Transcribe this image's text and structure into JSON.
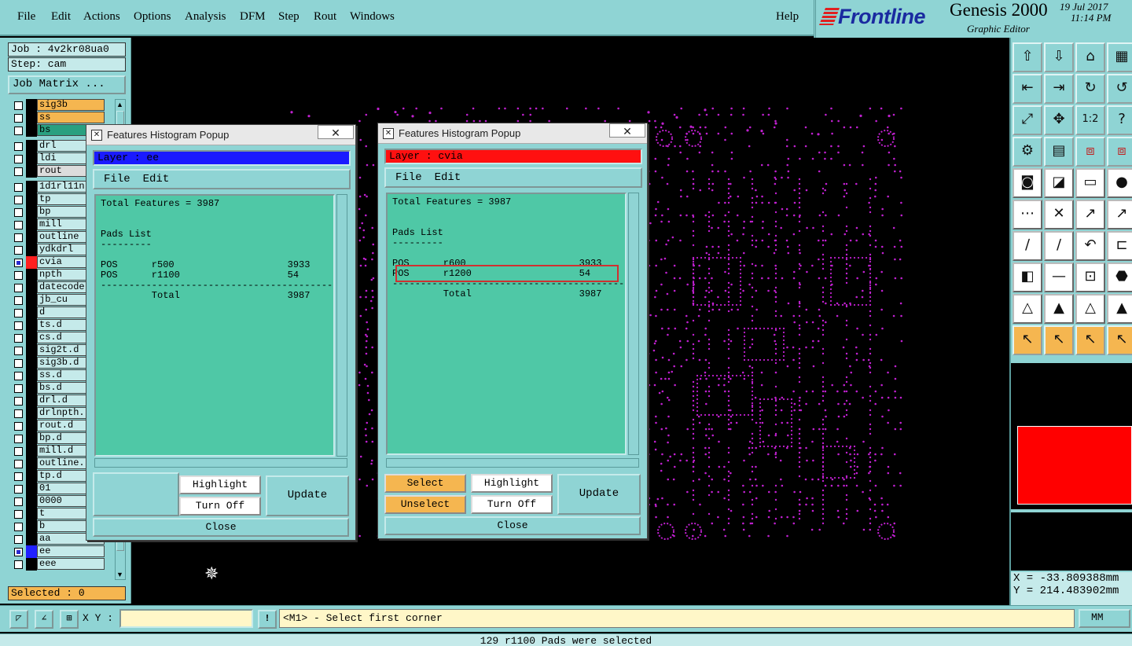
{
  "menubar": {
    "items": [
      "File",
      "Edit",
      "Actions",
      "Options",
      "Analysis",
      "DFM",
      "Step",
      "Rout",
      "Windows"
    ],
    "help": "Help"
  },
  "branding": {
    "logo": "Frontline",
    "product": "Genesis 2000",
    "subtitle": "Graphic Editor",
    "date": "19 Jul 2017",
    "time": "11:14 PM"
  },
  "job": {
    "job_label": "Job : 4v2kr08ua0",
    "step_label": "Step: cam",
    "matrix_button": "Job Matrix ..."
  },
  "layers": [
    {
      "name": "sig3b",
      "state": "sel",
      "arrow": true
    },
    {
      "name": "ss",
      "state": "sel",
      "arrow": true
    },
    {
      "name": "bs",
      "state": "bs",
      "arrow": true
    },
    {
      "name": "drl",
      "state": ""
    },
    {
      "name": "ldi",
      "state": ""
    },
    {
      "name": "rout",
      "state": "rt"
    },
    {
      "name": "1d1rl11n",
      "state": ""
    },
    {
      "name": "tp",
      "state": ""
    },
    {
      "name": "bp",
      "state": ""
    },
    {
      "name": "mill",
      "state": ""
    },
    {
      "name": "outline",
      "state": ""
    },
    {
      "name": "ydkdrl",
      "state": ""
    },
    {
      "name": "cvia",
      "state": "",
      "checked": true,
      "color": "#ff2020"
    },
    {
      "name": "npth",
      "state": ""
    },
    {
      "name": "datecode",
      "state": ""
    },
    {
      "name": "jb_cu",
      "state": ""
    },
    {
      "name": "d",
      "state": ""
    },
    {
      "name": "ts.d",
      "state": ""
    },
    {
      "name": "cs.d",
      "state": ""
    },
    {
      "name": "sig2t.d",
      "state": ""
    },
    {
      "name": "sig3b.d",
      "state": ""
    },
    {
      "name": "ss.d",
      "state": ""
    },
    {
      "name": "bs.d",
      "state": ""
    },
    {
      "name": "drl.d",
      "state": ""
    },
    {
      "name": "drlnpth.",
      "state": ""
    },
    {
      "name": "rout.d",
      "state": ""
    },
    {
      "name": "bp.d",
      "state": ""
    },
    {
      "name": "mill.d",
      "state": ""
    },
    {
      "name": "outline.",
      "state": ""
    },
    {
      "name": "tp.d",
      "state": ""
    },
    {
      "name": "01",
      "state": ""
    },
    {
      "name": "0000",
      "state": ""
    },
    {
      "name": "t",
      "state": ""
    },
    {
      "name": "b",
      "state": ""
    },
    {
      "name": "aa",
      "state": ""
    },
    {
      "name": "ee",
      "state": "",
      "checked": true,
      "color": "#2020ff"
    },
    {
      "name": "eee",
      "state": ""
    }
  ],
  "selected_label": "Selected : 0",
  "popup1": {
    "title": "Features Histogram Popup",
    "layer_label": "Layer :  ee",
    "layer_color": "#1a1aff",
    "menu": [
      "File",
      "Edit"
    ],
    "text": "Total Features = 3987\n\n\nPads List\n---------\n\nPOS      r500                    3933\nPOS      r1100                   54\n-------------------------------------------------\n         Total                   3987",
    "buttons": {
      "highlight": "Highlight",
      "turn_off": "Turn Off",
      "update": "Update",
      "close": "Close"
    }
  },
  "popup2": {
    "title": "Features Histogram Popup",
    "layer_label": "Layer :  cvia",
    "layer_color": "#ff1010",
    "menu": [
      "File",
      "Edit"
    ],
    "text": "Total Features = 3987\n\n\nPads List\n---------\n\nPOS      r600                    3933\nPOS      r1200                   54\n-------------------------------------------------\n         Total                   3987",
    "buttons": {
      "select": "Select",
      "unselect": "Unselect",
      "highlight": "Highlight",
      "turn_off": "Turn Off",
      "update": "Update",
      "close": "Close"
    }
  },
  "command": {
    "xy_label": "X Y :",
    "xy_value": "",
    "prompt": "<M1> - Select first corner",
    "units": "MM"
  },
  "coords": {
    "x": "X = -33.809388mm",
    "y": "Y = 214.483902mm"
  },
  "status": "129 r1100 Pads were selected",
  "colors": {
    "panel": "#8fd4d4",
    "pad_magenta": "#c020d0",
    "highlight_yellow": "#f5b650"
  }
}
